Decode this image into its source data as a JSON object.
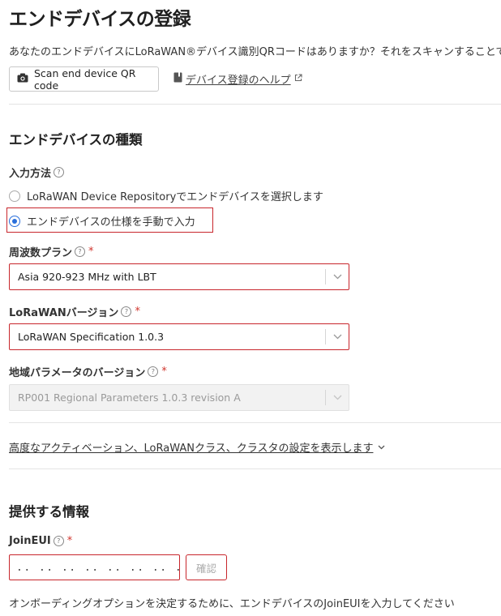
{
  "page": {
    "title": "エンドデバイスの登録",
    "intro": "あなたのエンドデバイスにLoRaWAN®デバイス識別QRコードはありますか？それをスキャンすることで登録"
  },
  "qr": {
    "button_label": "Scan end device QR code",
    "icon": "camera-icon"
  },
  "help": {
    "link_label": "デバイス登録のヘルプ",
    "icon": "book-icon",
    "external_icon": "external-link-icon"
  },
  "device_type": {
    "heading": "エンドデバイスの種類",
    "input_method": {
      "label": "入力方法",
      "options": [
        {
          "label": "LoRaWAN Device Repositoryでエンドデバイスを選択します",
          "selected": false
        },
        {
          "label": "エンドデバイスの仕様を手動で入力",
          "selected": true
        }
      ]
    },
    "frequency_plan": {
      "label": "周波数プラン",
      "required_mark": "*",
      "value": "Asia 920-923 MHz with LBT"
    },
    "lorawan_version": {
      "label": "LoRaWANバージョン",
      "required_mark": "*",
      "value": "LoRaWAN Specification 1.0.3"
    },
    "regional_params": {
      "label": "地域パラメータのバージョン",
      "required_mark": "*",
      "value": "RP001 Regional Parameters 1.0.3 revision A",
      "disabled": true
    },
    "advanced_link": "高度なアクティベーション、LoRaWANクラス、クラスタの設定を表示します"
  },
  "provided_info": {
    "heading": "提供する情報",
    "join_eui": {
      "label": "JoinEUI",
      "required_mark": "*",
      "placeholder": ".. .. .. .. .. .. .. ..",
      "confirm_label": "確認",
      "description": "オンボーディングオプションを決定するために、エンドデバイスのJoinEUIを入力してください"
    }
  },
  "colors": {
    "highlight": "#c8262c",
    "radio_accent": "#2a6fdb",
    "required": "#d0342c"
  }
}
